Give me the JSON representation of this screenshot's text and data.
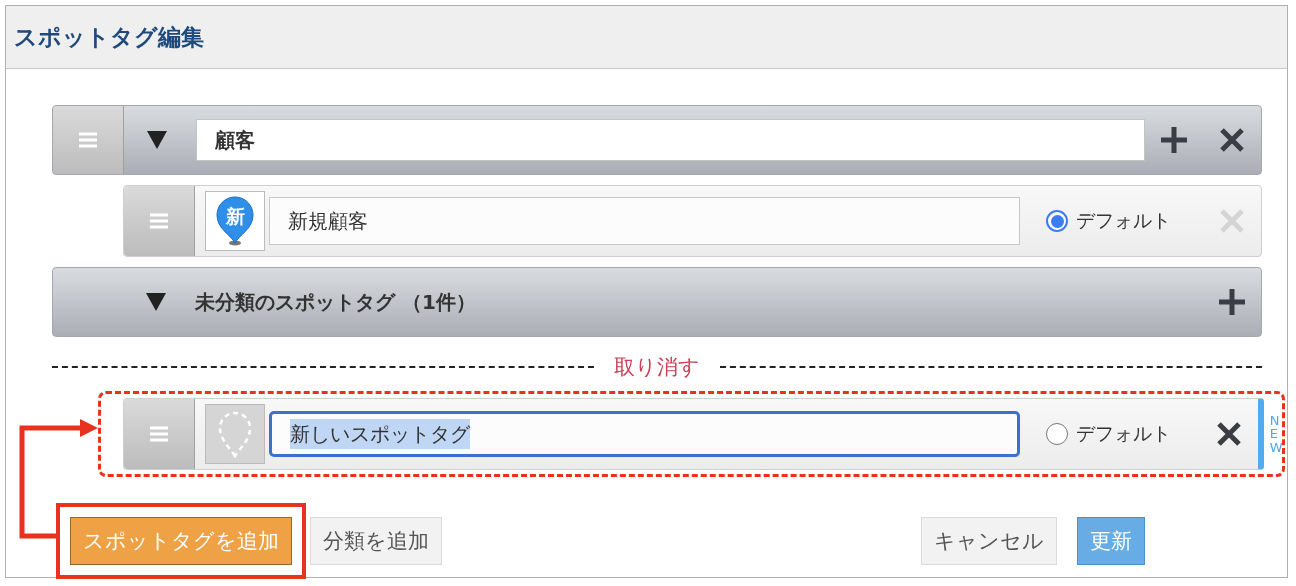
{
  "window": {
    "title": "スポットタグ編集"
  },
  "categories": [
    {
      "kind": "named",
      "name": "顧客",
      "expanded": true,
      "tags": [
        {
          "name": "新規顧客",
          "icon_text": "新",
          "default_label": "デフォルト",
          "default_selected": true,
          "delete_disabled": true
        }
      ]
    },
    {
      "kind": "uncategorized",
      "label": "未分類のスポットタグ （1件）",
      "expanded": true
    }
  ],
  "undo_label": "取り消す",
  "new_tag": {
    "value": "新しいスポットタグ",
    "text_selected": true,
    "default_label": "デフォルト",
    "default_selected": false,
    "delete_disabled": false,
    "badge": "NEW"
  },
  "add_buttons": [
    {
      "label": "スポットタグを追加",
      "kind": "primary",
      "highlighted": true
    },
    {
      "label": "分類を追加",
      "kind": "secondary",
      "highlighted": false
    }
  ],
  "footer_buttons": [
    {
      "label": "キャンセル",
      "kind": "secondary"
    },
    {
      "label": "更新",
      "kind": "accent"
    }
  ]
}
